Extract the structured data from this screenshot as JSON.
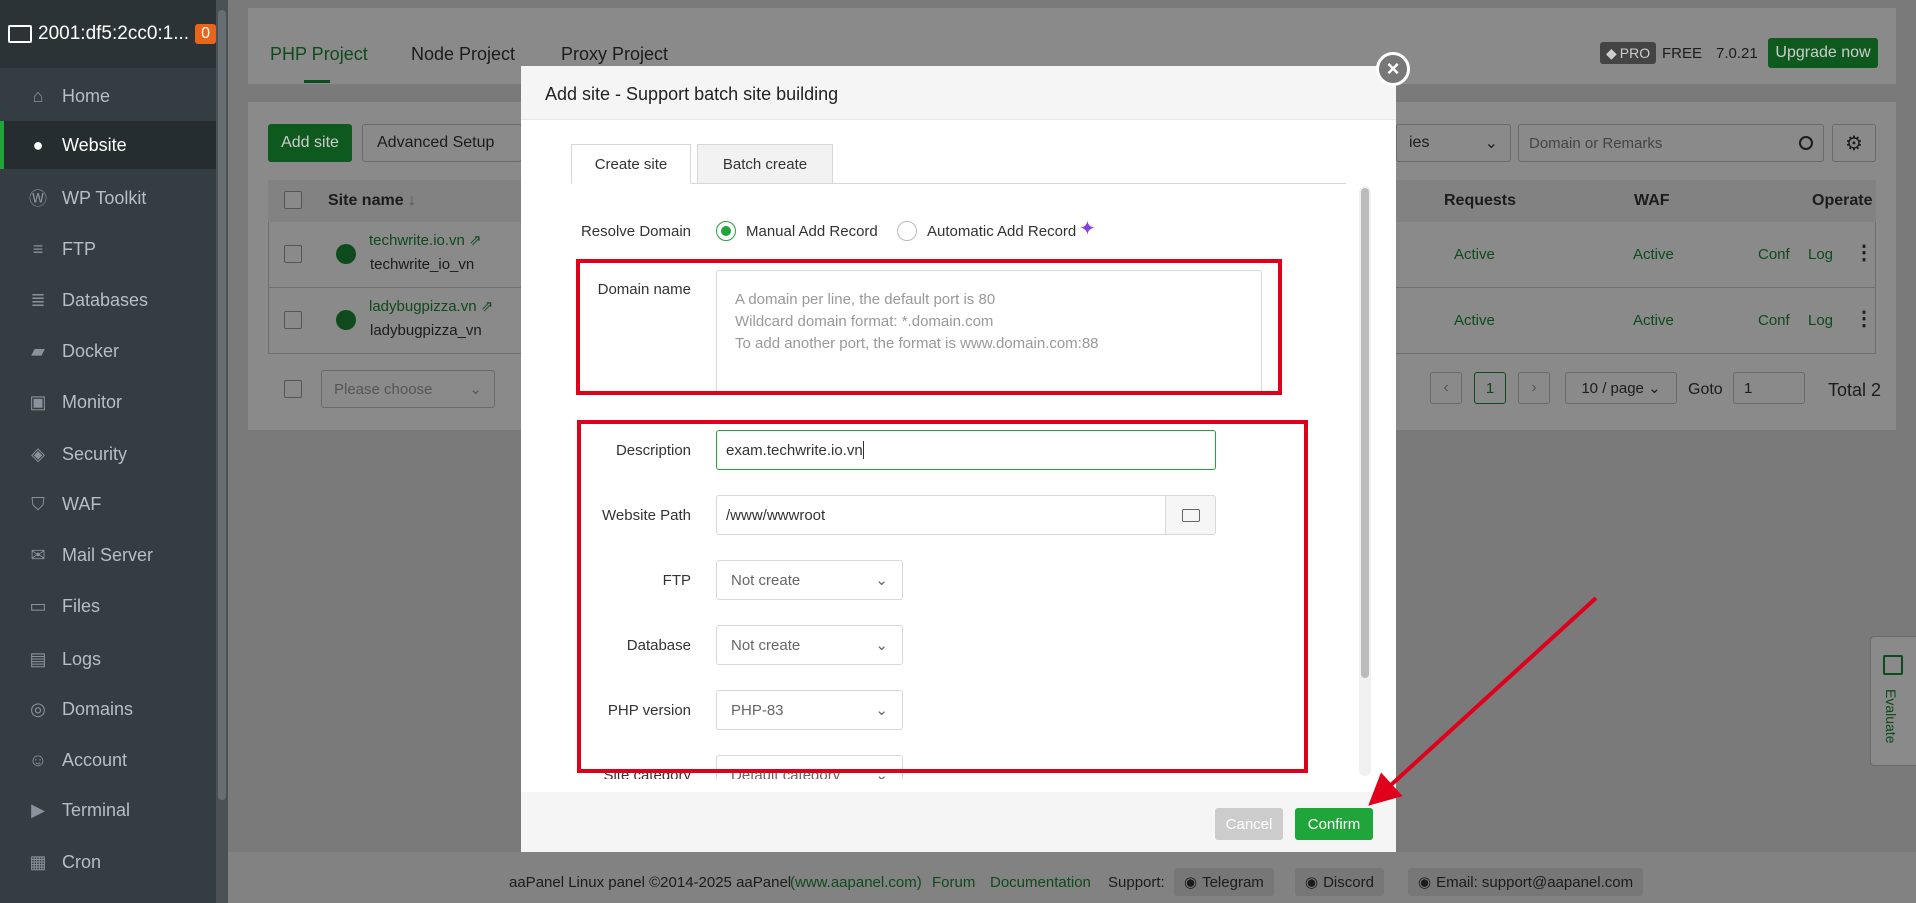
{
  "sidebar": {
    "server_name": "2001:df5:2cc0:1...",
    "server_badge": "0",
    "items": [
      {
        "label": "Home",
        "icon": "home-icon"
      },
      {
        "label": "Website",
        "icon": "globe-icon"
      },
      {
        "label": "WP Toolkit",
        "icon": "wordpress-icon"
      },
      {
        "label": "FTP",
        "icon": "ftp-icon"
      },
      {
        "label": "Databases",
        "icon": "database-icon"
      },
      {
        "label": "Docker",
        "icon": "docker-icon"
      },
      {
        "label": "Monitor",
        "icon": "monitor-icon"
      },
      {
        "label": "Security",
        "icon": "security-icon"
      },
      {
        "label": "WAF",
        "icon": "shield-icon"
      },
      {
        "label": "Mail Server",
        "icon": "mail-icon"
      },
      {
        "label": "Files",
        "icon": "folder-icon"
      },
      {
        "label": "Logs",
        "icon": "logs-icon"
      },
      {
        "label": "Domains",
        "icon": "domains-icon"
      },
      {
        "label": "Account",
        "icon": "user-icon"
      },
      {
        "label": "Terminal",
        "icon": "terminal-icon"
      },
      {
        "label": "Cron",
        "icon": "calendar-icon"
      }
    ]
  },
  "topbar": {
    "tabs": [
      "PHP Project",
      "Node Project",
      "Proxy Project"
    ],
    "pro_badge": "PRO",
    "free_label": "FREE",
    "version": "7.0.21",
    "upgrade_label": "Upgrade now"
  },
  "toolbar": {
    "add_site": "Add site",
    "advanced_setup": "Advanced Setup",
    "filter_partial": "ies",
    "search_placeholder": "Domain or Remarks"
  },
  "table": {
    "headers": {
      "site_name": "Site name",
      "requests": "Requests",
      "waf": "WAF",
      "operate": "Operate"
    },
    "rows": [
      {
        "name": "techwrite.io.vn",
        "remark": "techwrite_io_vn",
        "requests": "Active",
        "waf": "Active",
        "conf": "Conf",
        "log": "Log"
      },
      {
        "name": "ladybugpizza.vn",
        "remark": "ladybugpizza_vn",
        "requests": "Active",
        "waf": "Active",
        "conf": "Conf",
        "log": "Log"
      }
    ],
    "bulk_placeholder": "Please choose",
    "page_current": "1",
    "page_size": "10 / page",
    "goto_label": "Goto",
    "goto_value": "1",
    "total": "Total 2"
  },
  "modal": {
    "title": "Add site - Support batch site building",
    "tabs": [
      "Create site",
      "Batch create"
    ],
    "resolve_label": "Resolve Domain",
    "resolve_options": [
      "Manual Add Record",
      "Automatic Add Record"
    ],
    "domain_label": "Domain name",
    "domain_placeholder_lines": [
      "A domain per line, the default port is 80",
      "Wildcard domain format: *.domain.com",
      "To add another port, the format is www.domain.com:88"
    ],
    "description_label": "Description",
    "description_value": "exam.techwrite.io.vn",
    "path_label": "Website Path",
    "path_value": "/www/wwwroot",
    "ftp_label": "FTP",
    "ftp_value": "Not create",
    "database_label": "Database",
    "database_value": "Not create",
    "php_label": "PHP version",
    "php_value": "PHP-83",
    "category_label": "Site category",
    "category_value": "Default category",
    "cancel": "Cancel",
    "confirm": "Confirm"
  },
  "evaluate": "Evaluate",
  "footer": {
    "copyright": "aaPanel Linux panel ©2014-2025 aaPanel",
    "site_link": "(www.aapanel.com)",
    "forum": "Forum",
    "docs": "Documentation",
    "support": "Support:",
    "telegram": "Telegram",
    "discord": "Discord",
    "email": "Email: support@aapanel.com"
  },
  "colors": {
    "accent": "#20a53a",
    "annotation": "#e0001b"
  }
}
